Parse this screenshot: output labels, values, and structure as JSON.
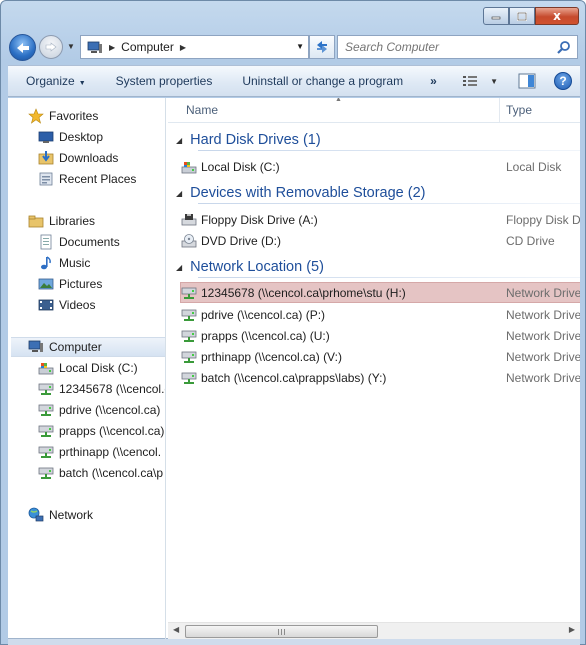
{
  "window": {
    "caption_buttons": [
      "minimize",
      "maximize",
      "close"
    ],
    "close_glyph": "x"
  },
  "nav": {
    "address_segments": [
      "Computer"
    ],
    "search_placeholder": "Search Computer"
  },
  "toolbar": {
    "organize": "Organize",
    "system_properties": "System properties",
    "uninstall": "Uninstall or change a program",
    "more": "»",
    "help_glyph": "?"
  },
  "sidebar": {
    "favorites": {
      "label": "Favorites",
      "items": [
        {
          "label": "Desktop",
          "icon": "desktop-icon"
        },
        {
          "label": "Downloads",
          "icon": "downloads-icon"
        },
        {
          "label": "Recent Places",
          "icon": "recent-places-icon"
        }
      ]
    },
    "libraries": {
      "label": "Libraries",
      "items": [
        {
          "label": "Documents",
          "icon": "documents-icon"
        },
        {
          "label": "Music",
          "icon": "music-icon"
        },
        {
          "label": "Pictures",
          "icon": "pictures-icon"
        },
        {
          "label": "Videos",
          "icon": "videos-icon"
        }
      ]
    },
    "computer": {
      "label": "Computer",
      "items": [
        {
          "label": "Local Disk (C:)",
          "icon": "local-disk-icon"
        },
        {
          "label": "12345678 (\\\\cencol.c",
          "icon": "network-drive-icon"
        },
        {
          "label": "pdrive (\\\\cencol.ca)",
          "icon": "network-drive-icon"
        },
        {
          "label": "prapps (\\\\cencol.ca)",
          "icon": "network-drive-icon"
        },
        {
          "label": "prthinapp (\\\\cencol.",
          "icon": "network-drive-icon"
        },
        {
          "label": "batch (\\\\cencol.ca\\p",
          "icon": "network-drive-icon"
        }
      ]
    },
    "network": {
      "label": "Network"
    }
  },
  "columns": {
    "name": "Name",
    "type": "Type"
  },
  "groups": [
    {
      "title": "Hard Disk Drives (1)",
      "items": [
        {
          "name": "Local Disk (C:)",
          "type": "Local Disk",
          "icon": "local-disk-icon"
        }
      ]
    },
    {
      "title": "Devices with Removable Storage (2)",
      "items": [
        {
          "name": "Floppy Disk Drive (A:)",
          "type": "Floppy Disk D",
          "icon": "floppy-drive-icon"
        },
        {
          "name": "DVD Drive (D:)",
          "type": "CD Drive",
          "icon": "dvd-drive-icon"
        }
      ]
    },
    {
      "title": "Network Location (5)",
      "items": [
        {
          "name": "12345678 (\\\\cencol.ca\\prhome\\stu (H:)",
          "type": "Network Drive",
          "icon": "network-drive-icon",
          "selected": true
        },
        {
          "name": "pdrive (\\\\cencol.ca) (P:)",
          "type": "Network Drive",
          "icon": "network-drive-icon"
        },
        {
          "name": "prapps (\\\\cencol.ca) (U:)",
          "type": "Network Drive",
          "icon": "network-drive-icon"
        },
        {
          "name": "prthinapp (\\\\cencol.ca) (V:)",
          "type": "Network Drive",
          "icon": "network-drive-icon"
        },
        {
          "name": "batch (\\\\cencol.ca\\prapps\\labs) (Y:)",
          "type": "Network Drive",
          "icon": "network-drive-icon"
        }
      ]
    }
  ],
  "colors": {
    "accent_blue": "#1e4e9a",
    "selection": "#e5c4c4",
    "toolbar_text": "#1e395b"
  }
}
